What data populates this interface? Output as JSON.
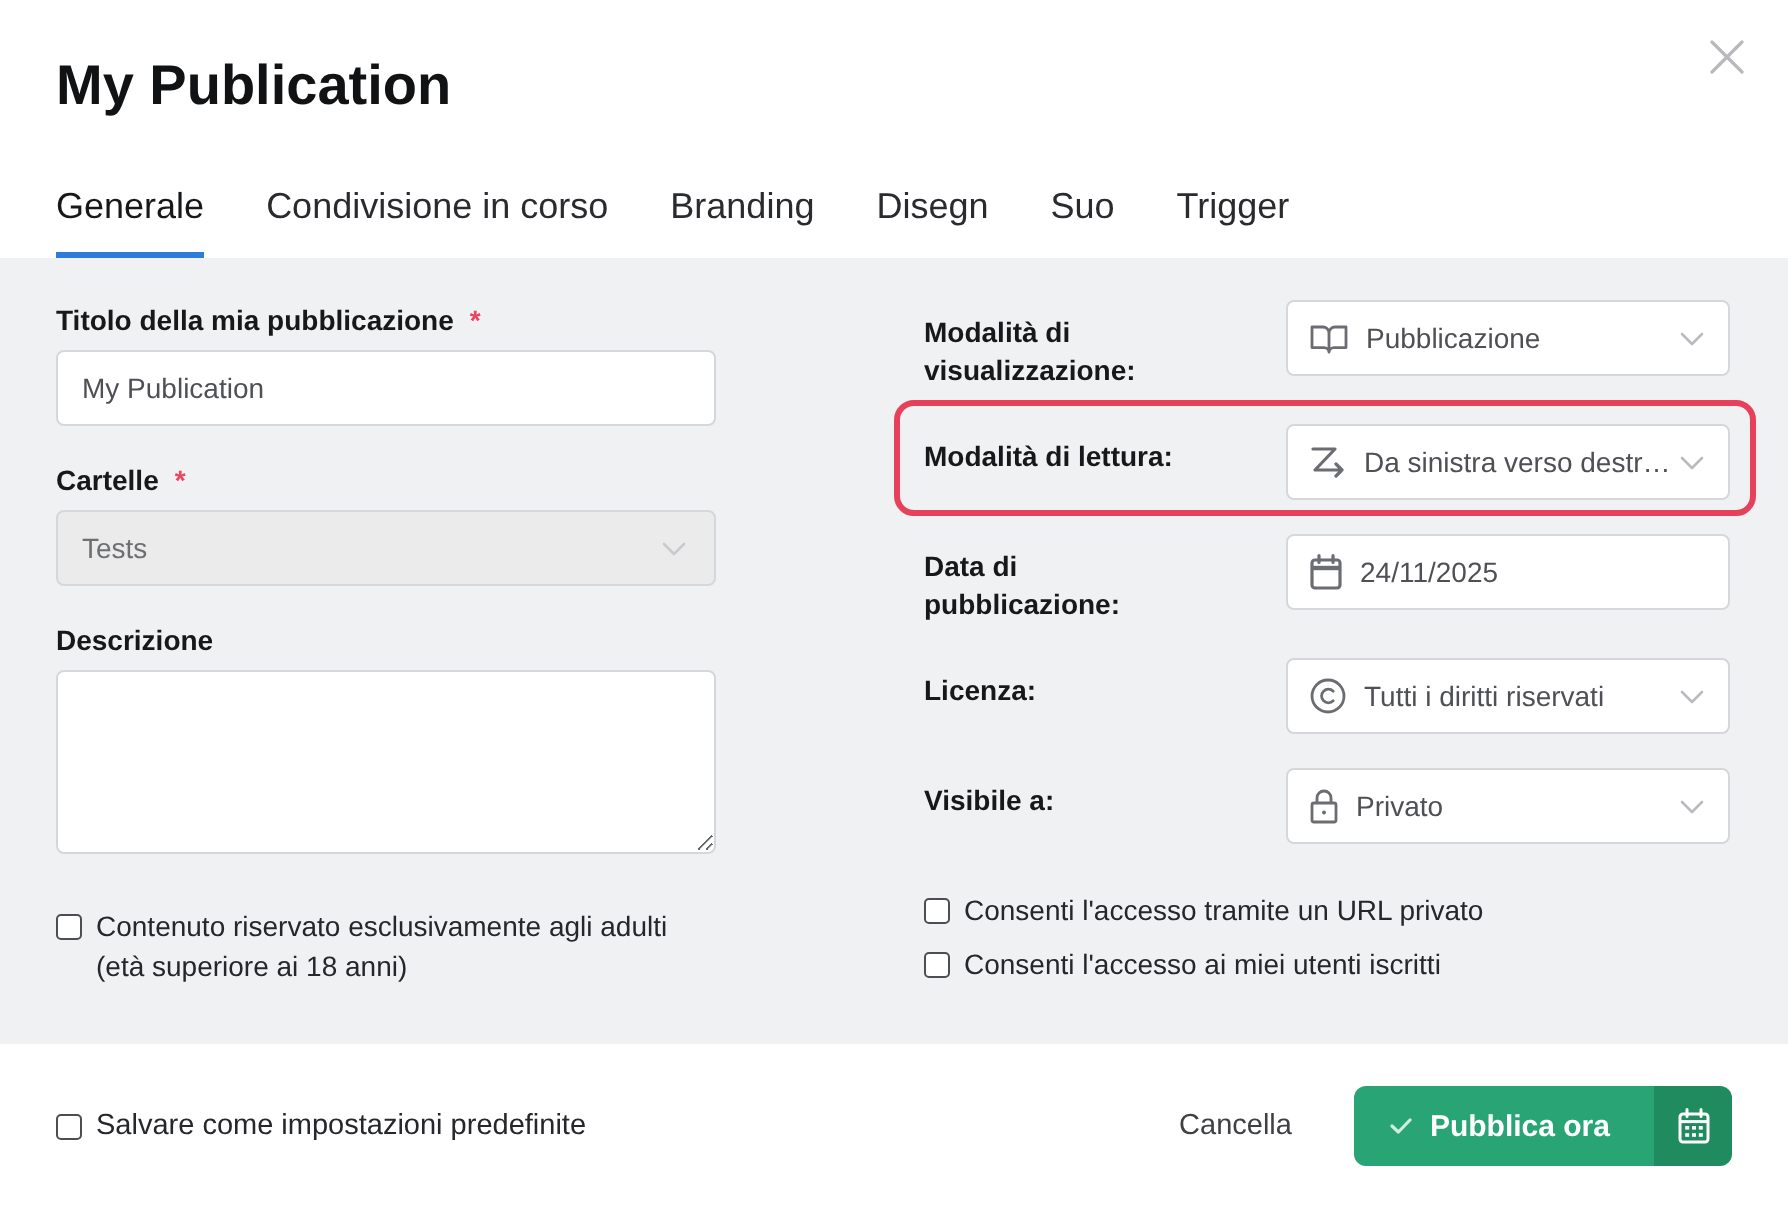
{
  "window": {
    "title": "My Publication"
  },
  "tabs": [
    {
      "label": "Generale",
      "selected": true
    },
    {
      "label": "Condivisione in corso",
      "selected": false
    },
    {
      "label": "Branding",
      "selected": false
    },
    {
      "label": "Disegn",
      "selected": false
    },
    {
      "label": "Suo",
      "selected": false
    },
    {
      "label": "Trigger",
      "selected": false
    }
  ],
  "left_fields": [
    {
      "kind": "text",
      "label": "Titolo della mia pubblicazione",
      "required_mark": "*",
      "value": "My Publication",
      "disabled": false
    },
    {
      "kind": "select",
      "label": "Cartelle",
      "required_mark": "*",
      "value": "Tests",
      "disabled": true
    },
    {
      "kind": "textarea",
      "label": "Descrizione",
      "disabled": false
    }
  ],
  "left_checkboxes": [
    {
      "label": "Contenuto riservato esclusivamente agli adulti (età superiore ai 18 anni)",
      "checked": false
    }
  ],
  "right_fields": [
    {
      "kind": "select",
      "label": "Modalità di visualizzazione:",
      "value": "Pubblicazione",
      "highlighted": false
    },
    {
      "kind": "select",
      "label": "Modalità di lettura:",
      "value": "Da sinistra verso destr…",
      "highlighted": true
    },
    {
      "kind": "date",
      "label": "Data di pubblicazione:",
      "value": "24/11/2025",
      "highlighted": false
    },
    {
      "kind": "select",
      "label": "Licenza:",
      "value": "Tutti i diritti riservati",
      "highlighted": false
    },
    {
      "kind": "select",
      "label": "Visibile a:",
      "value": "Privato",
      "highlighted": false
    }
  ],
  "right_checkboxes": [
    {
      "label": "Consenti l'accesso tramite un URL privato",
      "checked": false
    },
    {
      "label": "Consenti l'accesso ai miei utenti iscritti",
      "checked": false
    }
  ],
  "footer": {
    "default_checkbox": {
      "label": "Salvare come impostazioni predefinite",
      "checked": false
    },
    "cancel": "Cancella",
    "publish": "Pubblica ora"
  }
}
